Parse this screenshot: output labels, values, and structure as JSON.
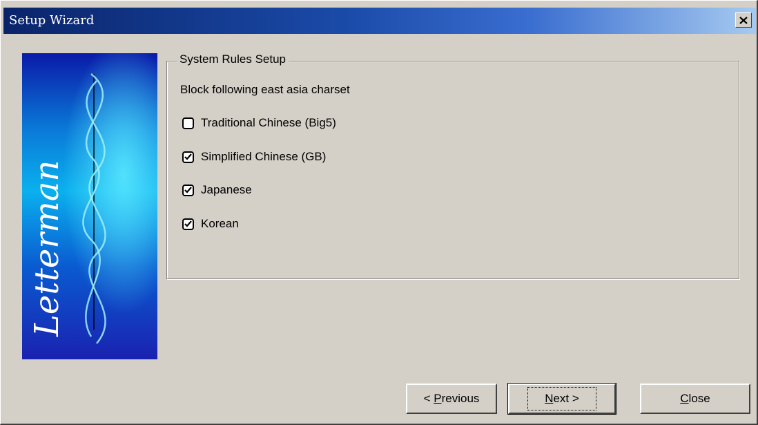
{
  "window": {
    "title": "Setup Wizard",
    "close_icon": "close-x-icon"
  },
  "banner": {
    "logo_text": "Letterman",
    "colors": {
      "top": "#0a1aa8",
      "middle": "#0aa8e8",
      "bottom": "#1a2ab8"
    }
  },
  "group": {
    "legend": "System Rules Setup",
    "instruction": "Block following east asia charset",
    "options": [
      {
        "label": "Traditional Chinese (Big5)",
        "checked": false
      },
      {
        "label": "Simplified Chinese (GB)",
        "checked": true
      },
      {
        "label": "Japanese",
        "checked": true
      },
      {
        "label": "Korean",
        "checked": true
      }
    ]
  },
  "buttons": {
    "previous": {
      "prefix": "< ",
      "mnemonic": "P",
      "rest": "revious"
    },
    "next": {
      "mnemonic": "N",
      "rest": "ext >"
    },
    "close": {
      "mnemonic": "C",
      "rest": "lose"
    }
  }
}
